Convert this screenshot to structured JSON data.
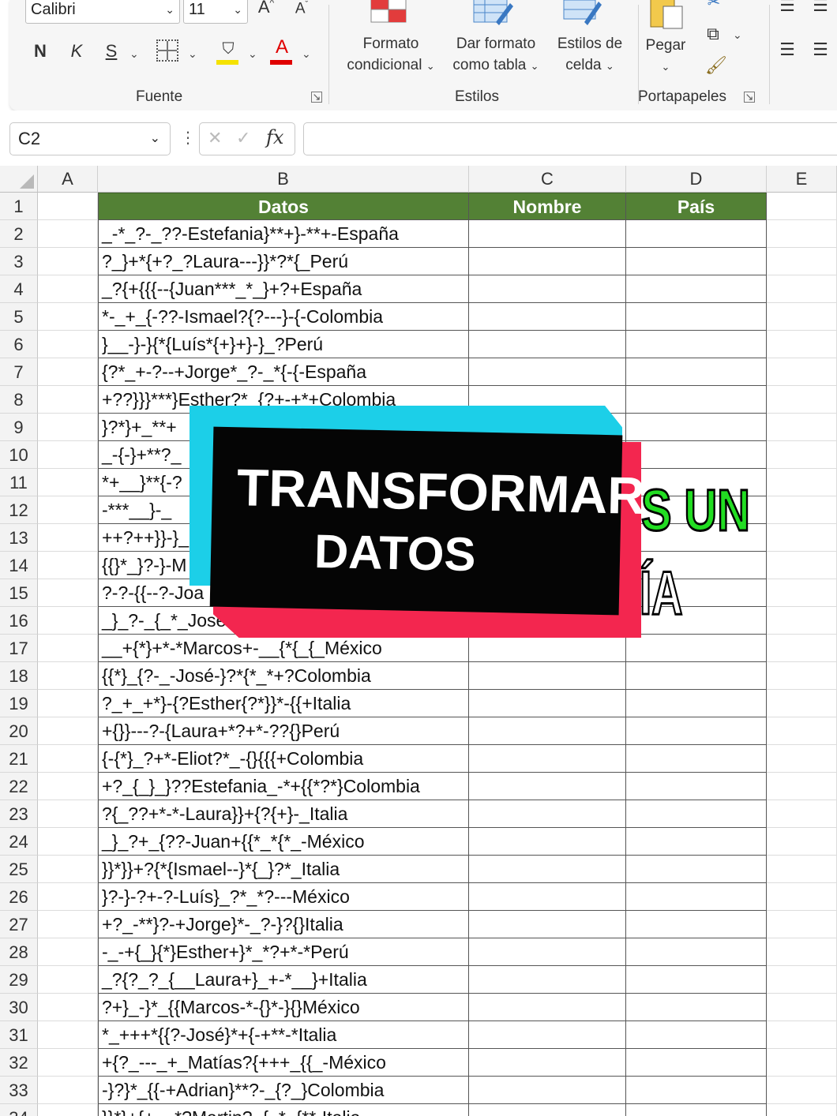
{
  "ribbon": {
    "font_name": "Calibri",
    "font_size": "11",
    "grow_font": "A",
    "shrink_font": "A",
    "bold": "N",
    "italic": "K",
    "underline": "S",
    "group_fuente": "Fuente",
    "cond_format_line1": "Formato",
    "cond_format_line2": "condicional",
    "format_table_line1": "Dar formato",
    "format_table_line2": "como tabla",
    "cell_styles_line1": "Estilos de",
    "cell_styles_line2": "celda",
    "group_estilos": "Estilos",
    "paste": "Pegar",
    "group_portapapeles": "Portapapeles",
    "colors": {
      "highlight": "#f5e200",
      "font_color": "#e00000"
    }
  },
  "formula_bar": {
    "name_box": "C2",
    "cancel": "✕",
    "enter": "✓",
    "fx": "fx",
    "formula": ""
  },
  "columns": [
    "A",
    "B",
    "C",
    "D",
    "E"
  ],
  "table": {
    "headers": {
      "datos": "Datos",
      "nombre": "Nombre",
      "pais": "País"
    },
    "header_color": "#538135",
    "rows": [
      "_-*_?-_??-Estefania}**+}-**+-España",
      "?_}+*{+?_?Laura---}}*?*{_Perú",
      "_?{+{{{--{Juan***_*_}+?+España",
      "*-_+_{-??-Ismael?{?---}-{-Colombia",
      "}__-}-}{*{Luís*{+}+}-}_?Perú",
      "{?*_+-?--+Jorge*_?-_*{-{-España",
      "+??}}}***}Esther?*_{?+-+*+Colombia",
      "}?*}+_**+",
      "_-{-}+**?_",
      "*+__}**{-?",
      "-***__}-_",
      "++?++}}-}_",
      "{{}*_}?-}-M",
      "?-?-{{--?-Joa",
      "_}_?-_{_*_Jose",
      "__+{*}+*-*Marcos+-__{*{_{_México",
      "{{*}_{?-_-José-}?*{*_*+?Colombia",
      "?_+_+*}-{?Esther{?*}}*-{{+Italia",
      "+{}}---?-{Laura+*?+*-??{}Perú",
      "{-{*}_?+*-Eliot?*_-{}{{{+Colombia",
      "+?_{_}_}??Estefania_-*+{{*?*}Colombia",
      "?{_??+*-*-Laura}}+{?{+}-_Italia",
      "_}_?+_{??-Juan+{{*_*{*_-México",
      "}}*}}+?{*{Ismael--}*{_}?*_Italia",
      "}?-}-?+-?-Luís}_?*_*?---México",
      "+?_-**}?-+Jorge}*-_?-}?{}Italia",
      "-_-+{_}{*}Esther+}*_*?+*-*Perú",
      "_?{?_?_{__Laura+}_+-*__}+Italia",
      "?+}_-}*_{{Marcos-*-{}*-}{}México",
      "*_+++*{{?-José}*+{-+**-*Italia",
      "+{?_---_+_Matías?{+++_{{_-México",
      "-}?}*_{{-+Adrian}**?-_{?_}Colombia",
      "}}*}+{+__*?Martin?_{_*_{**-Italia"
    ]
  },
  "overlay": {
    "line1": "TRANSFORMAR",
    "line2": "DATOS",
    "side_top": "S UN",
    "side_bottom": "ÍA"
  }
}
